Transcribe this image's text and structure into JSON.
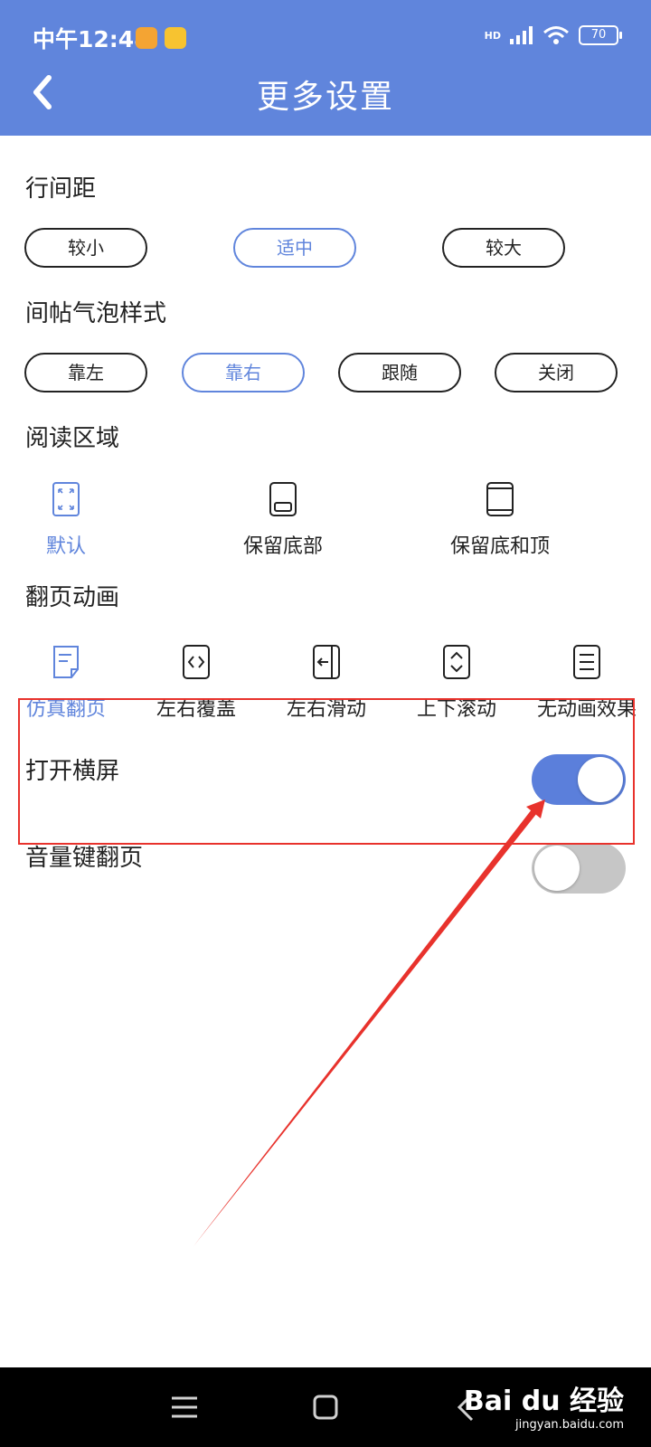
{
  "status_bar": {
    "time": "中午12:48",
    "battery": "70",
    "network": "HD"
  },
  "header": {
    "title": "更多设置"
  },
  "line_spacing": {
    "label": "行间距",
    "options": [
      "较小",
      "适中",
      "较大"
    ],
    "selected": "适中"
  },
  "bubble_style": {
    "label": "间帖气泡样式",
    "options": [
      "靠左",
      "靠右",
      "跟随",
      "关闭"
    ],
    "selected": "靠右"
  },
  "reading_area": {
    "label": "阅读区域",
    "options": [
      {
        "label": "默认",
        "icon": "expand-icon"
      },
      {
        "label": "保留底部",
        "icon": "reserve-bottom-icon"
      },
      {
        "label": "保留底和顶",
        "icon": "reserve-top-bottom-icon"
      }
    ],
    "selected": "默认"
  },
  "page_animation": {
    "label": "翻页动画",
    "options": [
      {
        "label": "仿真翻页",
        "icon": "page-curl-icon"
      },
      {
        "label": "左右覆盖",
        "icon": "horizontal-cover-icon"
      },
      {
        "label": "左右滑动",
        "icon": "horizontal-slide-icon"
      },
      {
        "label": "上下滚动",
        "icon": "vertical-scroll-icon"
      },
      {
        "label": "无动画效果",
        "icon": "no-animation-icon"
      }
    ],
    "selected": "仿真翻页"
  },
  "toggles": [
    {
      "label": "打开横屏",
      "on": true
    },
    {
      "label": "音量键翻页",
      "on": false
    }
  ],
  "watermark": {
    "main": "Bai du 经验",
    "sub": "jingyan.baidu.com"
  },
  "colors": {
    "accent": "#6085dc",
    "header_bg": "#6085dc",
    "annotation": "#e8322c",
    "toggle_off": "#c6c6c6"
  }
}
